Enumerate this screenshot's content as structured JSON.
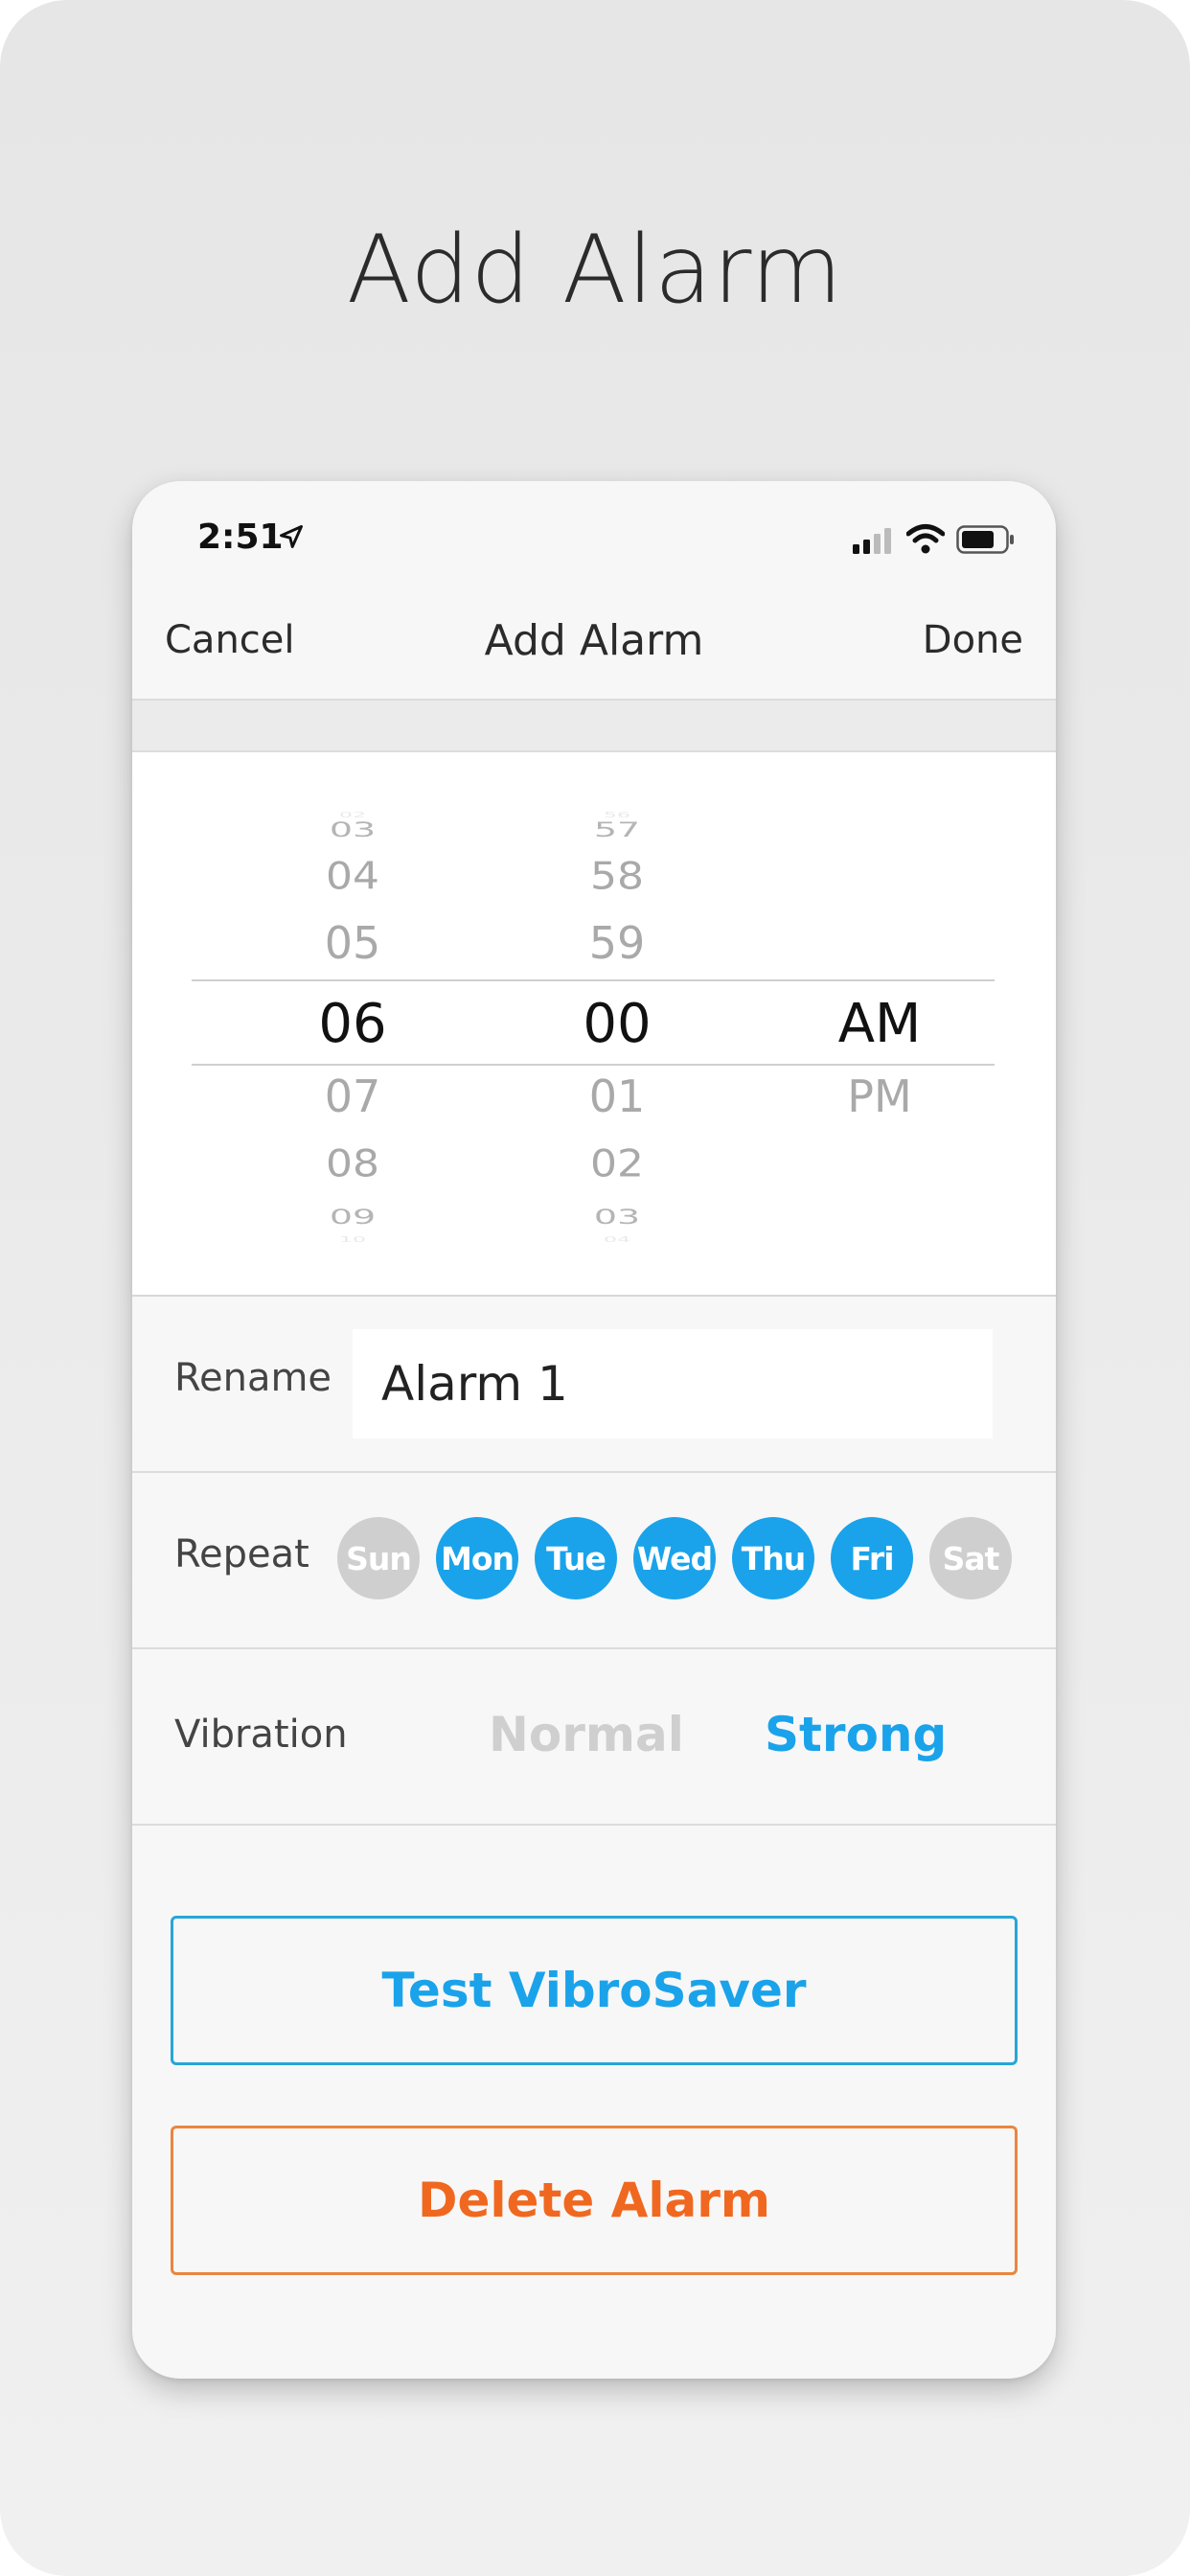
{
  "page": {
    "title": "Add Alarm"
  },
  "status_bar": {
    "time": "2:51"
  },
  "nav": {
    "cancel": "Cancel",
    "title": "Add Alarm",
    "done": "Done"
  },
  "picker": {
    "hours": [
      "02",
      "03",
      "04",
      "05",
      "06",
      "07",
      "08",
      "09",
      "10"
    ],
    "minutes": [
      "56",
      "57",
      "58",
      "59",
      "00",
      "01",
      "02",
      "03",
      "04"
    ],
    "ampm": [
      "AM",
      "PM"
    ],
    "selected": {
      "hour": "06",
      "minute": "00",
      "ampm": "AM"
    }
  },
  "rename": {
    "label": "Rename",
    "value": "Alarm 1"
  },
  "repeat": {
    "label": "Repeat",
    "days": [
      {
        "label": "Sun",
        "active": false
      },
      {
        "label": "Mon",
        "active": true
      },
      {
        "label": "Tue",
        "active": true
      },
      {
        "label": "Wed",
        "active": true
      },
      {
        "label": "Thu",
        "active": true
      },
      {
        "label": "Fri",
        "active": true
      },
      {
        "label": "Sat",
        "active": false
      }
    ]
  },
  "vibration": {
    "label": "Vibration",
    "options": [
      "Normal",
      "Strong"
    ],
    "selected": "Strong"
  },
  "buttons": {
    "test": "Test VibroSaver",
    "delete": "Delete Alarm"
  },
  "colors": {
    "accent": "#1aa3ea",
    "danger": "#f0681f",
    "inactive_day": "#cfcfcf"
  }
}
